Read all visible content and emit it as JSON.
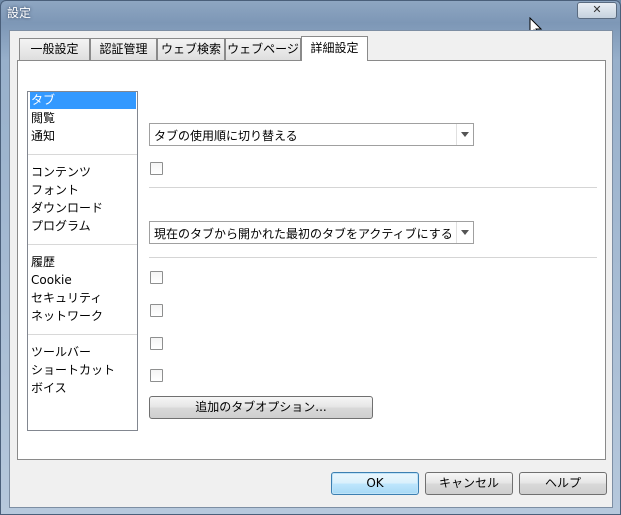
{
  "window": {
    "title": "設定",
    "close_label": "✕"
  },
  "tabs": [
    {
      "label": "一般設定"
    },
    {
      "label": "認証管理"
    },
    {
      "label": "ウェブ検索"
    },
    {
      "label": "ウェブページ"
    },
    {
      "label": "詳細設定"
    }
  ],
  "active_tab": "詳細設定",
  "sidebar": {
    "items": [
      {
        "label": "タブ",
        "selected": true
      },
      {
        "label": "閲覧"
      },
      {
        "label": "通知"
      },
      {
        "label": "コンテンツ"
      },
      {
        "label": "フォント"
      },
      {
        "label": "ダウンロード"
      },
      {
        "label": "プログラム"
      },
      {
        "label": "履歴"
      },
      {
        "label": "Cookie"
      },
      {
        "label": "セキュリティ"
      },
      {
        "label": "ネットワーク"
      },
      {
        "label": "ツールバー"
      },
      {
        "label": "ショートカット"
      },
      {
        "label": "ボイス"
      }
    ]
  },
  "content": {
    "tab_cycle_select": {
      "value": "タブの使用順に切り替える"
    },
    "tab_close_select": {
      "value": "現在のタブから開かれた最初のタブをアクティブにする"
    },
    "checkboxes": [
      {
        "checked": false
      },
      {
        "checked": false
      },
      {
        "checked": false
      },
      {
        "checked": false
      },
      {
        "checked": false
      }
    ],
    "more_tab_options_label": "追加のタブオプション..."
  },
  "footer": {
    "ok_label": "OK",
    "cancel_label": "キャンセル",
    "help_label": "ヘルプ"
  },
  "colors": {
    "selection": "#3399ff",
    "default_button_border": "#3c7fb1"
  }
}
